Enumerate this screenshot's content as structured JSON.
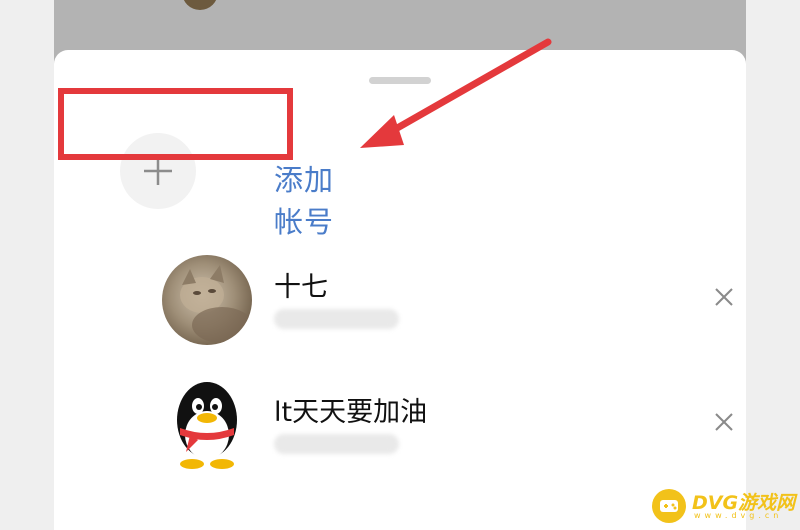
{
  "sheet": {
    "add_account_label": "添加帐号",
    "accounts": [
      {
        "name": "十七",
        "avatar": "cat-photo-avatar"
      },
      {
        "name": "lt天天要加油",
        "avatar": "qq-penguin-avatar"
      }
    ]
  },
  "watermark": {
    "brand": "DVG游戏网",
    "domain": "www.dvg.cn"
  },
  "colors": {
    "accent_blue": "#4a7cc9",
    "highlight_red": "#e4393c",
    "watermark_yellow": "#f2c21a"
  }
}
